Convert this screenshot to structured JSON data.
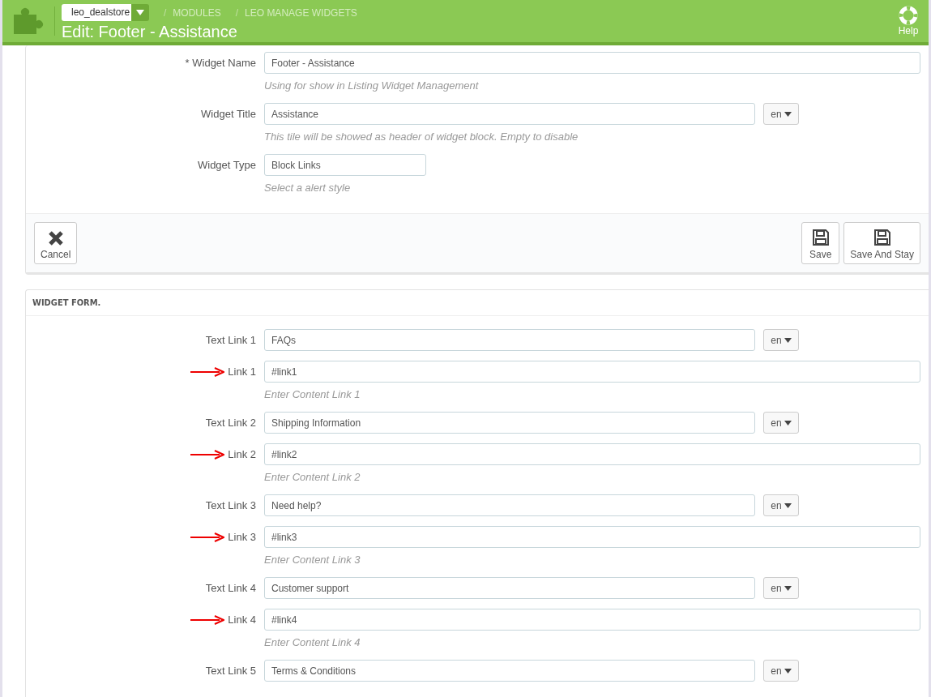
{
  "header": {
    "shop": "leo_dealstore",
    "breadcrumb": [
      {
        "separator": "/",
        "label": "MODULES"
      },
      {
        "separator": "/",
        "label": "LEO MANAGE WIDGETS"
      }
    ],
    "title": "Edit: Footer - Assistance",
    "help": "Help"
  },
  "settings": {
    "fields": [
      {
        "kind": "wide",
        "label": "* Widget Name",
        "value": "Footer - Assistance",
        "help": "Using for show in Listing Widget Management",
        "arrow": false
      },
      {
        "kind": "translatable",
        "label": "Widget Title",
        "value": "Assistance",
        "lang": "en",
        "help": "This tile will be showed as header of widget block. Empty to disable",
        "arrow": false
      },
      {
        "kind": "short",
        "label": "Widget Type",
        "value": "Block Links",
        "help": "Select a alert style",
        "arrow": false
      }
    ],
    "buttons": [
      {
        "kind": "cancel",
        "label": "Cancel"
      },
      {
        "kind": "save",
        "label": "Save"
      },
      {
        "kind": "save",
        "label": "Save And Stay"
      }
    ]
  },
  "widget_form": {
    "heading": "WIDGET FORM.",
    "fields": [
      {
        "kind": "translatable",
        "label": "Text Link 1",
        "value": "FAQs",
        "lang": "en",
        "arrow": false
      },
      {
        "kind": "wide",
        "label": "Link 1",
        "value": "#link1",
        "help": "Enter Content Link 1",
        "arrow": true
      },
      {
        "kind": "translatable",
        "label": "Text Link 2",
        "value": "Shipping Information",
        "lang": "en",
        "arrow": false
      },
      {
        "kind": "wide",
        "label": "Link 2",
        "value": "#link2",
        "help": "Enter Content Link 2",
        "arrow": true
      },
      {
        "kind": "translatable",
        "label": "Text Link 3",
        "value": "Need help?",
        "lang": "en",
        "arrow": false
      },
      {
        "kind": "wide",
        "label": "Link 3",
        "value": "#link3",
        "help": "Enter Content Link 3",
        "arrow": true
      },
      {
        "kind": "translatable",
        "label": "Text Link 4",
        "value": "Customer support",
        "lang": "en",
        "arrow": false
      },
      {
        "kind": "wide",
        "label": "Link 4",
        "value": "#link4",
        "help": "Enter Content Link 4",
        "arrow": true
      },
      {
        "kind": "translatable",
        "label": "Text Link 5",
        "value": "Terms & Conditions",
        "lang": "en",
        "arrow": false
      }
    ]
  }
}
